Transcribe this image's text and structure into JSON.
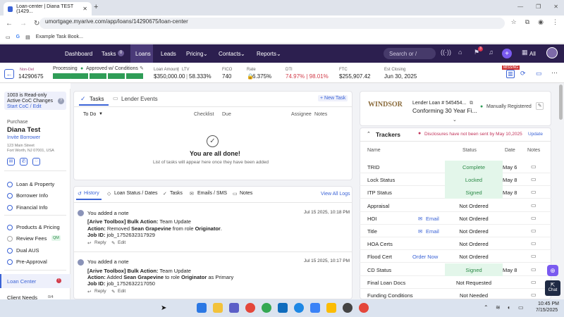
{
  "browser": {
    "tab_title": "Loan-center | Diana TEST (1429...",
    "url": "umortgage.myarive.com/app/loans/14290675/loan-center",
    "bookmark": "Example Task Book..."
  },
  "nav": {
    "dashboard": "Dashboard",
    "tasks": "Tasks",
    "tasks_badge": "0",
    "loans": "Loans",
    "leads": "Leads",
    "pricing": "Pricing",
    "contacts": "Contacts",
    "reports": "Reports",
    "search_placeholder": "Search or /",
    "notif_badge": "3",
    "all": "All"
  },
  "loan_header": {
    "status_tag": "Non-Del",
    "loan_number": "14290675",
    "processing": "Processing",
    "approved": "Approved w/ Conditions",
    "amount_label": "Loan Amount",
    "ltv_label": "LTV",
    "amount": "$350,000.00",
    "ltv": "58.333%",
    "fico_label": "FICO",
    "fico": "740",
    "rate_label": "Rate",
    "rate": "6.375%",
    "dti_label": "DTI",
    "dti": "74.97% | 98.01%",
    "ftc_label": "FTC",
    "ftc": "$255,907.42",
    "close_label": "Est Closing",
    "close": "Jun 30, 2025",
    "top_badge": "MISSING"
  },
  "left": {
    "read_only": "1003 is Read-only",
    "coc": "Active CoC Changes",
    "start_coc": "Start CoC / Edit",
    "purpose": "Purchase",
    "borrower": "Diana Test",
    "invite": "Invite Borrower",
    "address1": "123 Main Street",
    "address2": "Fort Worth, NJ 07001, USA",
    "items": [
      "Loan & Property",
      "Borrower Info",
      "Financial Info",
      "Products & Pricing",
      "Review Fees",
      "Dual AUS",
      "Pre-Approval"
    ],
    "review_badge": "QM",
    "loan_center": "Loan Center",
    "client_needs": "Client Needs",
    "client_badge": "0/4"
  },
  "tasks": {
    "tab_tasks": "Tasks",
    "tab_lender": "Lender Events",
    "new_task": "+ New Task",
    "todo": "To Do",
    "col_checklist": "Checklist",
    "col_due": "Due",
    "col_assignee": "Assignee",
    "col_notes": "Notes",
    "done_title": "You are all done!",
    "done_sub": "List of tasks will appear here once they have been added"
  },
  "history": {
    "tabs": [
      "History",
      "Loan Status / Dates",
      "Tasks",
      "Emails / SMS",
      "Notes"
    ],
    "view_all": "View All Logs",
    "entries": [
      {
        "who": "You added a note",
        "time": "Jul 15 2025, 10:18 PM",
        "line1a": "[Arive Toolbox] Bulk Action:",
        "line1b": " Team Update",
        "line2a": "Action:",
        "line2b": " Removed ",
        "line2c": "Sean Grapevine",
        "line2d": " from role ",
        "line2e": "Originator",
        "line2f": ".",
        "line3a": "Job ID:",
        "line3b": " job_1752632317929"
      },
      {
        "who": "You added a note",
        "time": "Jul 15 2025, 10:17 PM",
        "line1a": "[Arive Toolbox] Bulk Action:",
        "line1b": " Team Update",
        "line2a": "Action:",
        "line2b": " Added ",
        "line2c": "Sean Grapevine",
        "line2d": " to role ",
        "line2e": "Originator",
        "line2f": " as Primary",
        "line3a": "Job ID:",
        "line3b": " job_1752632217050"
      }
    ],
    "reply": "Reply",
    "edit": "Edit"
  },
  "lender": {
    "logo": "WINDSOR",
    "loan_label": "Lender Loan # 545454...",
    "product": "Conforming 30 Year Fi...",
    "registered": "Manually Registered"
  },
  "trackers": {
    "title": "Trackers",
    "warning": "Disclosures have not been sent by May 10,2025",
    "update": "Update",
    "col_name": "Name",
    "col_status": "Status",
    "col_date": "Date",
    "col_notes": "Notes",
    "rows": [
      {
        "name": "TRID",
        "action": "",
        "status": "Complete",
        "date": "May 6",
        "green": true
      },
      {
        "name": "Lock Status",
        "action": "",
        "status": "Locked",
        "date": "May 8",
        "green": true
      },
      {
        "name": "ITP Status",
        "action": "",
        "status": "Signed",
        "date": "May 8",
        "green": true
      },
      {
        "name": "Appraisal",
        "action": "",
        "status": "Not Ordered",
        "date": "",
        "green": false
      },
      {
        "name": "HOI",
        "action": "Email",
        "status": "Not Ordered",
        "date": "",
        "green": false
      },
      {
        "name": "Title",
        "action": "Email",
        "status": "Not Ordered",
        "date": "",
        "green": false
      },
      {
        "name": "HOA Certs",
        "action": "",
        "status": "Not Ordered",
        "date": "",
        "green": false
      },
      {
        "name": "Flood Cert",
        "action": "Order Now",
        "status": "Not Ordered",
        "date": "",
        "green": false
      },
      {
        "name": "CD Status",
        "action": "",
        "status": "Signed",
        "date": "May 8",
        "green": true
      },
      {
        "name": "Final Loan Docs",
        "action": "",
        "status": "Not Requested",
        "date": "",
        "green": false
      },
      {
        "name": "Funding Conditions",
        "action": "",
        "status": "Not Needed",
        "date": "",
        "green": false
      }
    ]
  },
  "chat": "Chat",
  "clock": {
    "time": "10:45 PM",
    "date": "7/15/2025"
  }
}
